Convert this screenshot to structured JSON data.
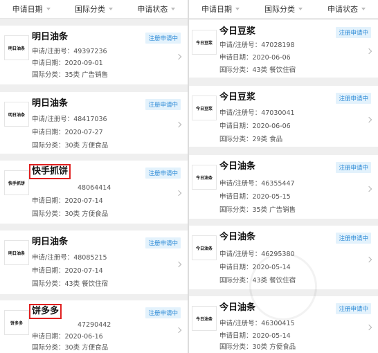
{
  "filters": {
    "date": "申请日期",
    "class": "国际分类",
    "status": "申请状态"
  },
  "left_cards": [
    {
      "logo": "明日油条",
      "title": "明日油条",
      "reg": "申请/注册号：49397236",
      "date": "申请日期：2020-09-01",
      "class": "国际分类：35类 广告销售",
      "status": "注册申请中"
    },
    {
      "logo": "明日油条",
      "title": "明日油条",
      "reg": "申请/注册号：48417036",
      "date": "申请日期：2020-07-27",
      "class": "国际分类：30类 方便食品",
      "status": "注册申请中"
    },
    {
      "logo": "快手抓饼",
      "title": "快手抓饼",
      "reg": "48064414",
      "date": "申请日期：2020-07-14",
      "class": "国际分类：30类 方便食品",
      "status": "注册申请中"
    },
    {
      "logo": "明日油条",
      "title": "明日油条",
      "reg": "申请/注册号：48085215",
      "date": "申请日期：2020-07-14",
      "class": "国际分类：43类 餐饮住宿",
      "status": "注册申请中"
    },
    {
      "logo": "饼多多",
      "title": "饼多多",
      "reg": "47290442",
      "date": "申请日期：2020-06-16",
      "class": "国际分类：30类 方便食品",
      "status": "注册申请中"
    }
  ],
  "right_cards": [
    {
      "logo": "今日豆浆",
      "title": "今日豆浆",
      "reg": "申请/注册号：47028198",
      "date": "申请日期：2020-06-06",
      "class": "国际分类：43类 餐饮住宿",
      "status": "注册申请中"
    },
    {
      "logo": "今日豆浆",
      "title": "今日豆浆",
      "reg": "申请/注册号：47030041",
      "date": "申请日期：2020-06-06",
      "class": "国际分类：29类 食品",
      "status": "注册申请中"
    },
    {
      "logo": "今日油条",
      "title": "今日油条",
      "reg": "申请/注册号：46355447",
      "date": "申请日期：2020-05-15",
      "class": "国际分类：35类 广告销售",
      "status": "注册申请中"
    },
    {
      "logo": "今日油条",
      "title": "今日油条",
      "reg": "申请/注册号：46295380",
      "date": "申请日期：2020-05-14",
      "class": "国际分类：43类 餐饮住宿",
      "status": "注册申请中"
    },
    {
      "logo": "今日油条",
      "title": "今日油条",
      "reg": "申请/注册号：46300415",
      "date": "申请日期：2020-05-14",
      "class": "国际分类：30类 方便食品",
      "status": "注册申请中"
    }
  ]
}
